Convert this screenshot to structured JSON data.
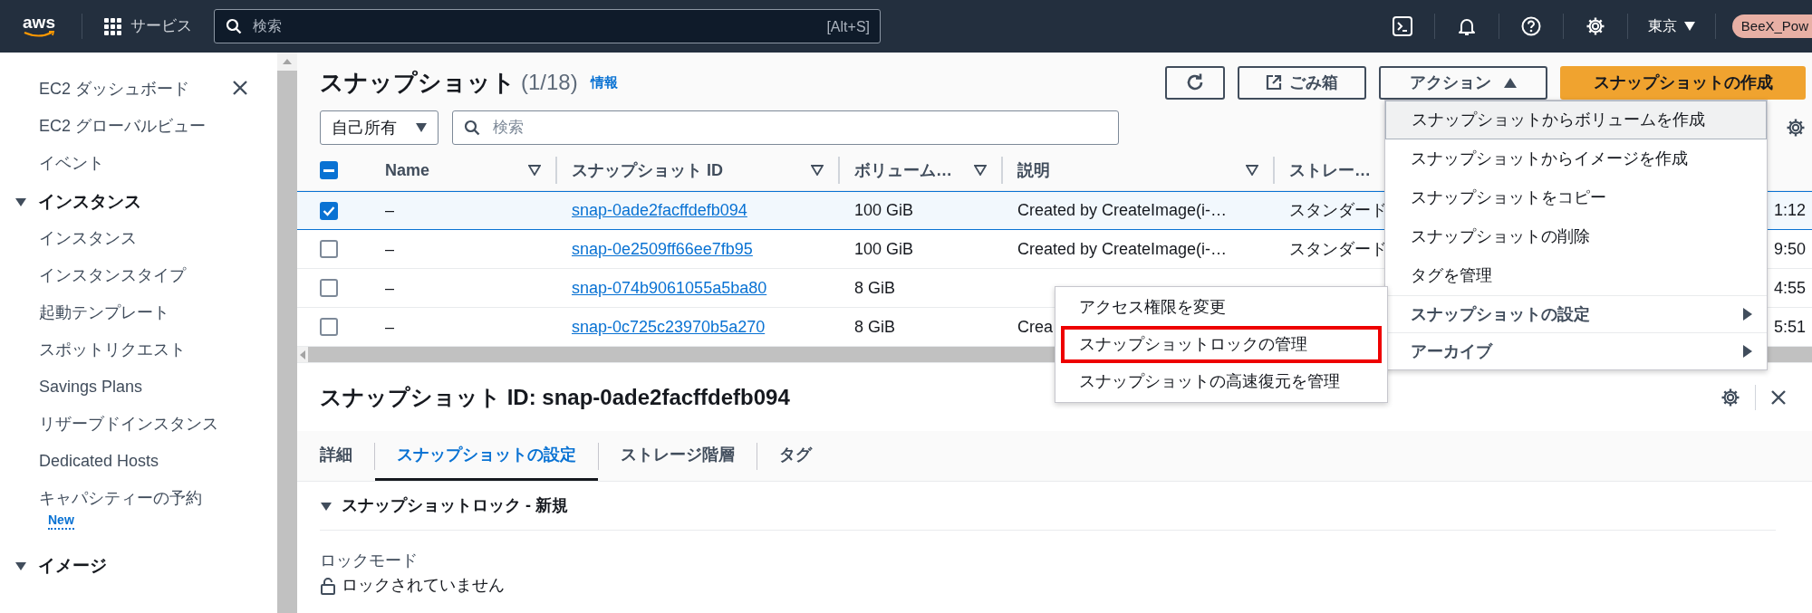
{
  "top_nav": {
    "logo": "aws",
    "services_label": "サービス",
    "search": {
      "placeholder": "検索",
      "shortcut": "[Alt+S]"
    },
    "region": "東京",
    "account": "BeeX_Pow"
  },
  "sidebar": {
    "links": [
      {
        "label": "EC2 ダッシュボード"
      },
      {
        "label": "EC2 グローバルビュー"
      },
      {
        "label": "イベント"
      }
    ],
    "sections": [
      {
        "label": "インスタンス",
        "expanded": true,
        "children": [
          {
            "label": "インスタンス"
          },
          {
            "label": "インスタンスタイプ"
          },
          {
            "label": "起動テンプレート"
          },
          {
            "label": "スポットリクエスト"
          },
          {
            "label": "Savings Plans"
          },
          {
            "label": "リザーブドインスタンス"
          },
          {
            "label": "Dedicated Hosts"
          },
          {
            "label": "キャパシティーの予約",
            "badge": "New"
          }
        ]
      },
      {
        "label": "イメージ",
        "expanded": true
      }
    ]
  },
  "snapshots_panel": {
    "title": "スナップショット",
    "count": "(1/18)",
    "info_link": "情報",
    "trash_button": "ごみ箱",
    "actions_button": "アクション",
    "create_button": "スナップショットの作成",
    "owner_filter": "自己所有",
    "search": {
      "placeholder": "検索"
    },
    "table": {
      "indeterminate": true,
      "columns": [
        "Name",
        "スナップショット ID",
        "ボリューム…",
        "説明",
        "ストレー…"
      ],
      "rows": [
        {
          "selected": true,
          "name": "–",
          "snapshot_id": "snap-0ade2facffdefb094",
          "volume": "100 GiB",
          "description": "Created by CreateImage(i-…",
          "storage": "スタンダード",
          "column_7": "1:12"
        },
        {
          "selected": false,
          "name": "–",
          "snapshot_id": "snap-0e2509ff66ee7fb95",
          "volume": "100 GiB",
          "description": "Created by CreateImage(i-…",
          "storage": "スタンダード",
          "column_7": "9:50"
        },
        {
          "selected": false,
          "name": "–",
          "snapshot_id": "snap-074b9061055a5ba80",
          "volume": "8 GiB",
          "column_7": "4:55"
        },
        {
          "selected": false,
          "name": "–",
          "snapshot_id": "snap-0c725c23970b5a270",
          "volume": "8 GiB",
          "description": "Crea",
          "column_7": "5:51"
        }
      ]
    }
  },
  "actions_menu": {
    "items": [
      {
        "kind": "item",
        "label": "スナップショットからボリュームを作成",
        "hovered": true
      },
      {
        "kind": "item",
        "label": "スナップショットからイメージを作成",
        "hovered": false
      },
      {
        "kind": "item",
        "label": "スナップショットをコピー",
        "hovered": false
      },
      {
        "kind": "item",
        "label": "スナップショットの削除",
        "hovered": false
      },
      {
        "kind": "item",
        "label": "タグを管理",
        "hovered": false
      },
      {
        "kind": "submenu",
        "label": "スナップショットの設定",
        "expanded": true,
        "children": [
          {
            "label": "アクセス権限を変更",
            "emphasis_box": false
          },
          {
            "label": "スナップショットロックの管理",
            "emphasis_box": true
          },
          {
            "label": "スナップショットの高速復元を管理",
            "emphasis_box": false
          }
        ]
      },
      {
        "kind": "submenu",
        "label": "アーカイブ"
      }
    ]
  },
  "detail_panel": {
    "title": "スナップショット ID: snap-0ade2facffdefb094",
    "tabs": [
      {
        "label": "詳細",
        "selected": false
      },
      {
        "label": "スナップショットの設定",
        "selected": true
      },
      {
        "label": "ストレージ階層",
        "selected": false
      },
      {
        "label": "タグ",
        "selected": false
      }
    ],
    "section": {
      "title": "スナップショットロック - 新規",
      "expanded": true
    },
    "fields": [
      {
        "label": "ロックモード",
        "value": "ロックされていません",
        "locked": false
      }
    ]
  }
}
